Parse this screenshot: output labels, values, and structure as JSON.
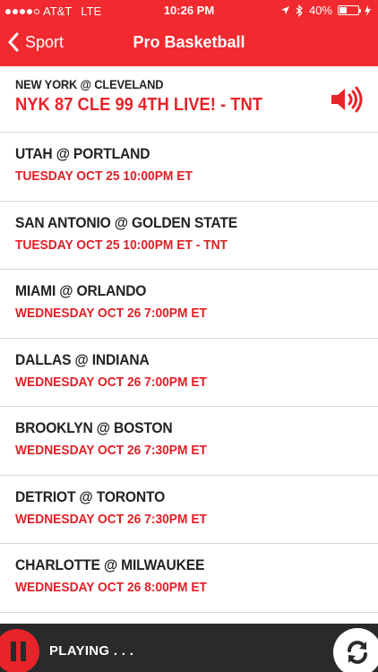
{
  "status_bar": {
    "carrier": "AT&T",
    "network": "LTE",
    "time": "10:26 PM",
    "battery_text": "40%",
    "battery_level": 0.4,
    "signal_bars": 4
  },
  "nav": {
    "back_label": "Sport",
    "title": "Pro Basketball"
  },
  "featured": {
    "matchup": "NEW YORK @ CLEVELAND",
    "status": "NYK 87 CLE 99 4TH LIVE! - TNT"
  },
  "games": [
    {
      "matchup": "UTAH @ PORTLAND",
      "when": "TUESDAY OCT 25 10:00PM ET"
    },
    {
      "matchup": "SAN ANTONIO @ GOLDEN STATE",
      "when": "TUESDAY OCT 25 10:00PM ET - TNT"
    },
    {
      "matchup": "MIAMI @ ORLANDO",
      "when": "WEDNESDAY OCT 26 7:00PM ET"
    },
    {
      "matchup": "DALLAS @ INDIANA",
      "when": "WEDNESDAY OCT 26 7:00PM ET"
    },
    {
      "matchup": "BROOKLYN @ BOSTON",
      "when": "WEDNESDAY OCT 26 7:30PM ET"
    },
    {
      "matchup": "DETRIOT @ TORONTO",
      "when": "WEDNESDAY OCT 26 7:30PM ET"
    },
    {
      "matchup": "CHARLOTTE @ MILWAUKEE",
      "when": "WEDNESDAY OCT 26 8:00PM ET"
    }
  ],
  "player": {
    "status": "PLAYING . . ."
  },
  "colors": {
    "accent": "#f02a2f",
    "live_text": "#e8232a",
    "player_bg": "#2a2a2a"
  }
}
